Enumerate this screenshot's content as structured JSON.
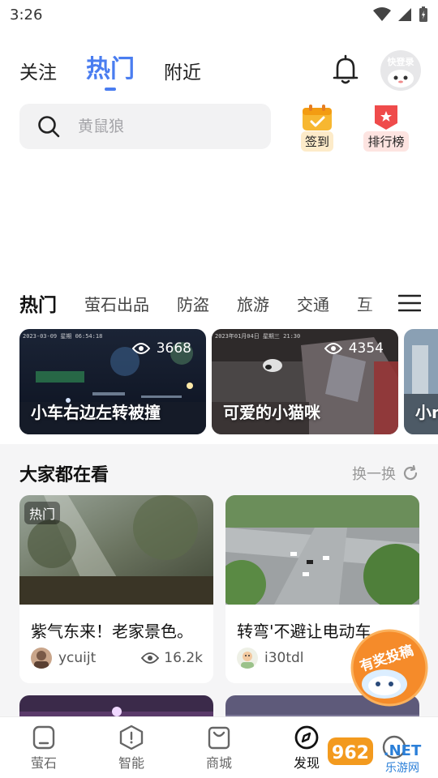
{
  "status_bar": {
    "time": "3:26"
  },
  "top_tabs": [
    {
      "label": "关注"
    },
    {
      "label": "热门",
      "active": true
    },
    {
      "label": "附近"
    }
  ],
  "avatar_label": "快登录",
  "search": {
    "placeholder": "黄鼠狼"
  },
  "quick_actions": {
    "sign_in": "签到",
    "ranking": "排行榜"
  },
  "categories": [
    "热门",
    "萤石出品",
    "防盗",
    "旅游",
    "交通",
    "互"
  ],
  "hot_videos": [
    {
      "title": "小车右边左转被撞",
      "views": "3668",
      "stamp": "2023-03-09  星期  06:54:18"
    },
    {
      "title": "可爱的小猫咪",
      "views": "4354",
      "stamp": "2023年01月04日 星期三 21:30"
    },
    {
      "title": "小n",
      "views": ""
    }
  ],
  "section": {
    "title": "大家都在看",
    "refresh_label": "换一换"
  },
  "feed": [
    {
      "tag": "热门",
      "title": "紫气东来！老家景色。",
      "user": "ycuijt",
      "views": "16.2k"
    },
    {
      "tag": "",
      "title": "转弯'不避让电动车",
      "user": "i30tdl",
      "views": ""
    }
  ],
  "reward_button": "有奖投稿",
  "bottom_nav": [
    {
      "label": "萤石",
      "icon": "home-icon"
    },
    {
      "label": "智能",
      "icon": "smart-icon"
    },
    {
      "label": "商城",
      "icon": "shop-icon"
    },
    {
      "label": "发现",
      "icon": "compass-icon",
      "active": true
    },
    {
      "label": "",
      "icon": "profile-icon"
    }
  ],
  "watermark": {
    "brand": "962.NET",
    "sub": "乐游网"
  },
  "colors": {
    "accent": "#4a7df0",
    "sign_bg": "#fdebc9",
    "rank_bg": "#fde4e1",
    "reward": "#f58b2a"
  }
}
